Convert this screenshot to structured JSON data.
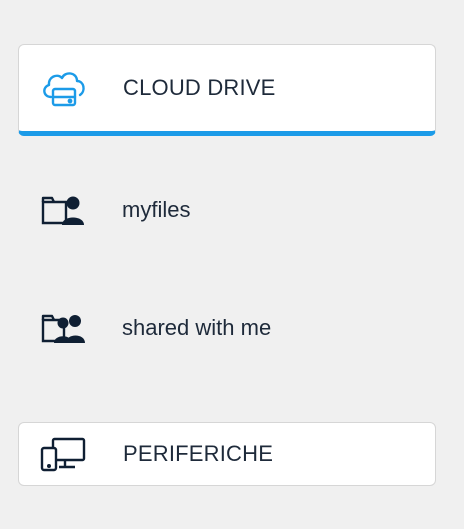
{
  "colors": {
    "accent": "#1c9be8",
    "text": "#1e2a3a",
    "icon_dark": "#0f1f33",
    "background": "#f0f0f0",
    "card": "#ffffff"
  },
  "sidebar": {
    "items": [
      {
        "label": "CLOUD DRIVE",
        "icon": "cloud-drive-icon",
        "active": true
      },
      {
        "label": "myfiles",
        "icon": "folder-user-icon",
        "active": false
      },
      {
        "label": "shared with me",
        "icon": "folder-users-icon",
        "active": false
      },
      {
        "label": "PERIFERICHE",
        "icon": "devices-icon",
        "active": false
      }
    ]
  }
}
